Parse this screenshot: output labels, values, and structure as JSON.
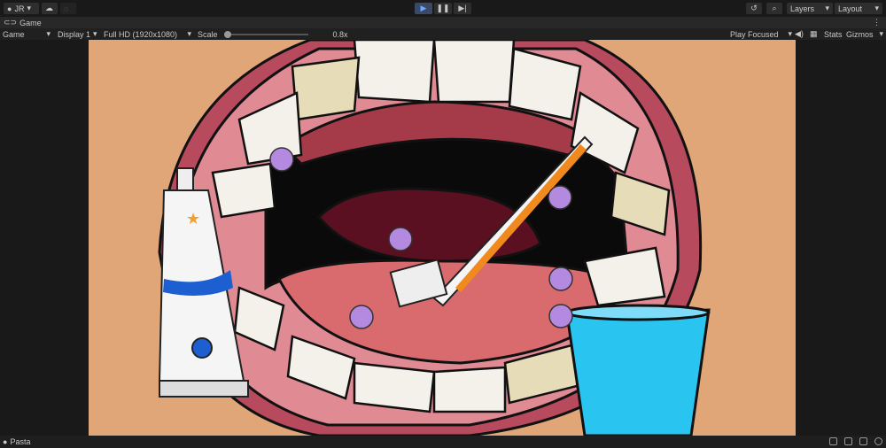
{
  "toolbar": {
    "account": "JR",
    "layers": "Layers",
    "layout": "Layout"
  },
  "tab": {
    "title": "Game"
  },
  "game_bar": {
    "mode": "Game",
    "display": "Display 1",
    "resolution": "Full HD (1920x1080)",
    "scale_label": "Scale",
    "scale_value": "0.8x",
    "play_mode": "Play Focused",
    "stats": "Stats",
    "gizmos": "Gizmos"
  },
  "status": {
    "text": "Pasta"
  },
  "colors": {
    "background": "#e0a678",
    "cup": "#29c4f0",
    "brush_accent": "#f08a1e",
    "germ": "#b48ae0"
  }
}
